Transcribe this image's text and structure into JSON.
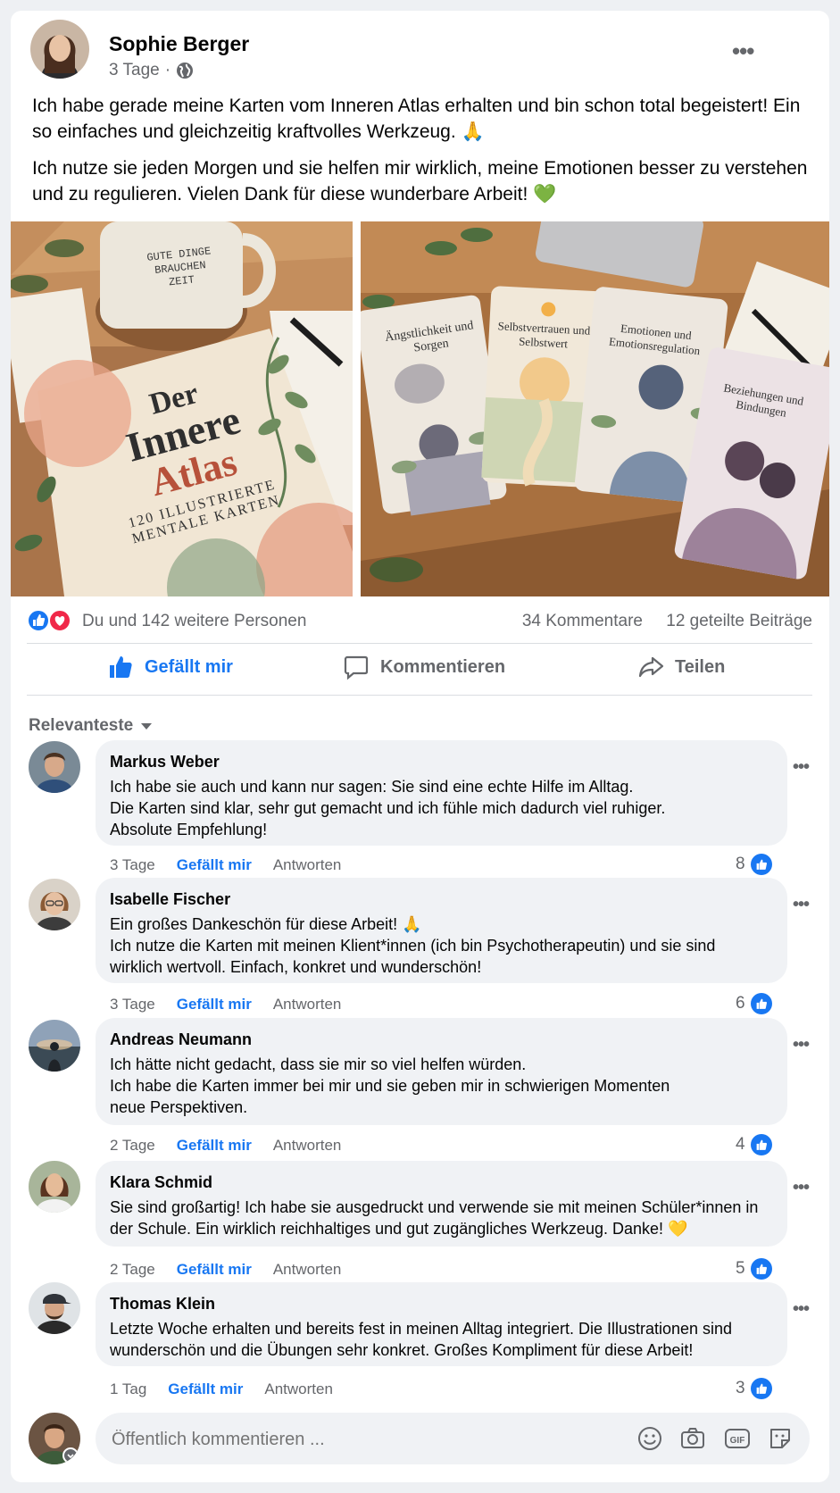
{
  "post": {
    "author": "Sophie Berger",
    "time": "3 Tage",
    "separator": "·",
    "paragraph1": "Ich habe gerade meine Karten vom Inneren Atlas erhalten und bin schon total begeistert! Ein so einfaches und gleichzeitig kraftvolles Werkzeug. 🙏",
    "paragraph2": "Ich nutze sie jeden Morgen und sie helfen mir wirklich, meine Emotionen besser zu verstehen und zu regulieren. Vielen Dank für diese wunderbare Arbeit! 💚"
  },
  "book": {
    "mug_text": "GUTE DINGE BRAUCHEN ZEIT",
    "title_line1": "Der",
    "title_line2": "Innere",
    "title_line3": "Atlas",
    "subtitle1": "120 ILLUSTRIERTE",
    "subtitle2": "MENTALE KARTEN"
  },
  "cards": [
    {
      "title": "Ängstlichkeit und Sorgen"
    },
    {
      "title": "Selbstvertrauen und Selbstwert"
    },
    {
      "title": "Emotionen und Emotionsregulation"
    },
    {
      "title": "Beziehungen und Bindungen"
    }
  ],
  "stats": {
    "reactions_text": "Du und 142 weitere Personen",
    "comments": "34 Kommentare",
    "shares": "12 geteilte Beiträge"
  },
  "actions": {
    "like": "Gefällt mir",
    "comment": "Kommentieren",
    "share": "Teilen"
  },
  "sort_label": "Relevanteste",
  "comments": [
    {
      "name": "Markus Weber",
      "text": "Ich habe sie auch und kann nur sagen: Sie sind eine echte Hilfe im Alltag.\nDie Karten sind klar, sehr gut gemacht und ich fühle mich dadurch viel ruhiger.\nAbsolute Empfehlung!",
      "time": "3 Tage",
      "like": "Gefällt mir",
      "reply": "Antworten",
      "likes": "8"
    },
    {
      "name": "Isabelle Fischer",
      "text": "Ein großes Dankeschön für diese Arbeit! 🙏\nIch nutze die Karten mit meinen Klient*innen (ich bin Psychotherapeutin) und sie sind wirklich wertvoll. Einfach, konkret und wunderschön!",
      "time": "3 Tage",
      "like": "Gefällt mir",
      "reply": "Antworten",
      "likes": "6"
    },
    {
      "name": "Andreas Neumann",
      "text": "Ich hätte nicht gedacht, dass sie mir so viel helfen würden.\nIch habe die Karten immer bei mir und sie geben mir in schwierigen Momenten\nneue Perspektiven.",
      "time": "2 Tage",
      "like": "Gefällt mir",
      "reply": "Antworten",
      "likes": "4"
    },
    {
      "name": "Klara Schmid",
      "text": "Sie sind großartig! Ich habe sie ausgedruckt und verwende sie mit meinen Schüler*innen in der Schule. Ein wirklich reichhaltiges und gut zugängliches Werkzeug. Danke! 💛",
      "time": "2 Tage",
      "like": "Gefällt mir",
      "reply": "Antworten",
      "likes": "5"
    },
    {
      "name": "Thomas Klein",
      "text": "Letzte Woche erhalten und bereits fest in meinen Alltag integriert. Die Illustrationen sind wunderschön und die Übungen sehr konkret. Großes Kompliment für diese Arbeit!",
      "time": "1 Tag",
      "like": "Gefällt mir",
      "reply": "Antworten",
      "likes": "3"
    }
  ],
  "composer": {
    "placeholder": "Öffentlich kommentieren ..."
  },
  "colors": {
    "accent": "#1877f2",
    "love": "#f02849",
    "secondary_text": "#65676b",
    "bubble": "#f0f2f5"
  },
  "icons": [
    "globe-icon",
    "more-options-icon",
    "like-reaction-icon",
    "love-reaction-icon",
    "thumbs-up-icon",
    "comment-icon",
    "share-icon",
    "caret-down-icon",
    "emoji-icon",
    "camera-icon",
    "gif-icon",
    "sticker-icon"
  ]
}
